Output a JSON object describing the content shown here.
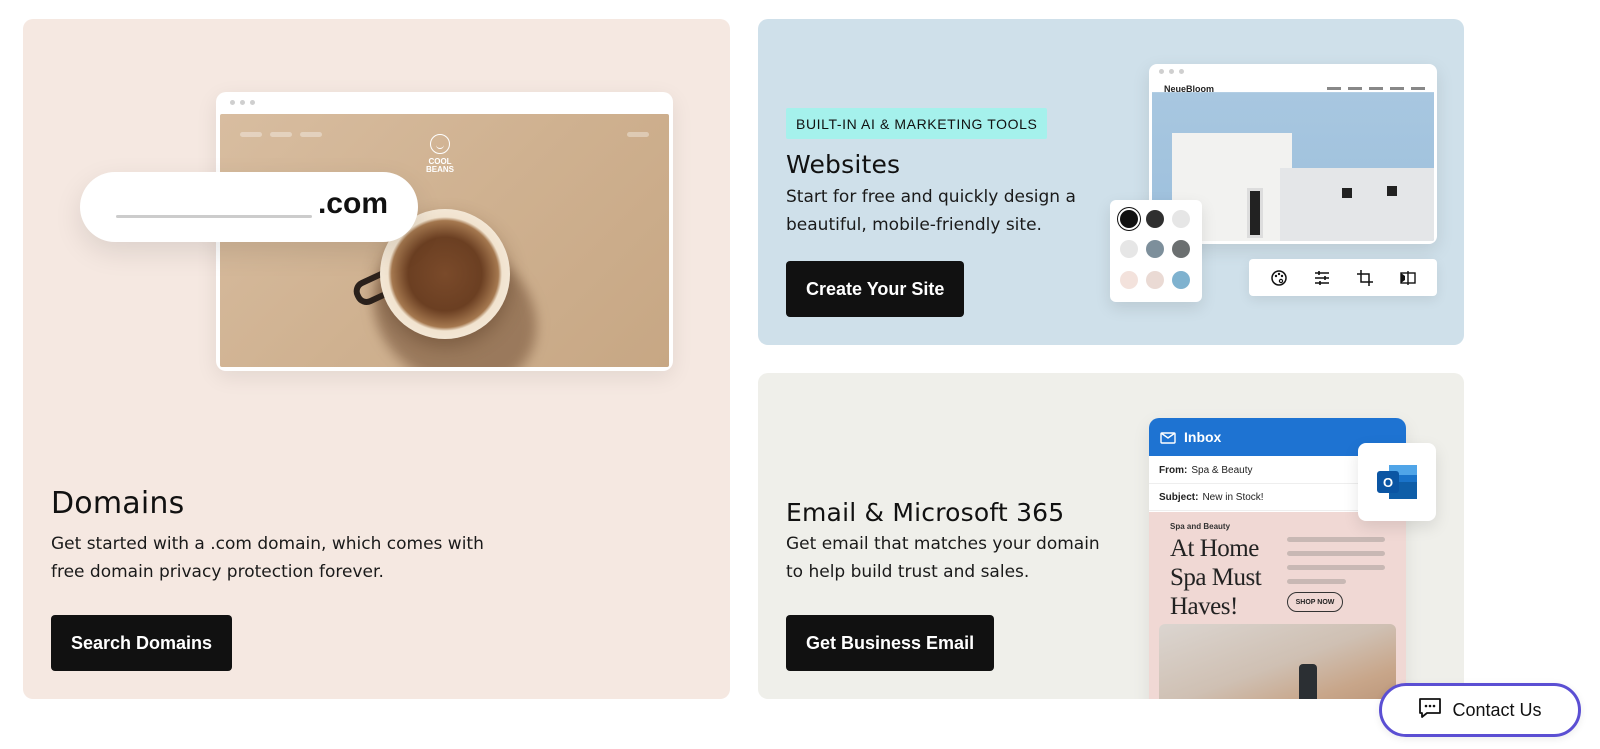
{
  "domains_card": {
    "title": "Domains",
    "description": "Get started with a .com domain, which comes with free domain privacy protection forever.",
    "cta_label": "Search Domains",
    "illustration": {
      "tld": ".com",
      "logo_text_line1": "COOL",
      "logo_text_line2": "BEANS"
    }
  },
  "websites_card": {
    "tag": "BUILT-IN AI & MARKETING TOOLS",
    "title": "Websites",
    "description": "Start for free and quickly design a beautiful, mobile-friendly site.",
    "cta_label": "Create Your Site",
    "illustration": {
      "site_logo": "NeueBloom",
      "swatch_colors": [
        "#111111",
        "#2f2f2f",
        "#e6e6e6",
        "#e6e6e6",
        "#7d8f9b",
        "#6b6f70",
        "#f3e2dc",
        "#eadad4",
        "#7fb2cf"
      ],
      "tool_icons": [
        "palette-icon",
        "adjust-sliders-icon",
        "crop-icon",
        "compare-icon"
      ]
    }
  },
  "email_card": {
    "title": "Email & Microsoft 365",
    "description": "Get email that matches your domain to help build trust and sales.",
    "cta_label": "Get Business Email",
    "illustration": {
      "inbox_label": "Inbox",
      "from_label": "From:",
      "from_value": "Spa & Beauty",
      "subject_label": "Subject:",
      "subject_value": "New in Stock!",
      "promo_brand": "Spa and Beauty",
      "promo_headline": "At Home Spa Must Haves!",
      "promo_button": "SHOP NOW",
      "outlook_letter": "O"
    }
  },
  "contact": {
    "label": "Contact Us"
  },
  "colors": {
    "domains_bg": "#f5e8e1",
    "websites_bg": "#cfe0ea",
    "email_bg": "#efefea",
    "cta_bg": "#111111",
    "tag_bg": "#a5f1ec",
    "inbox_blue": "#1e73d2",
    "contact_border": "#5b4fd3"
  }
}
